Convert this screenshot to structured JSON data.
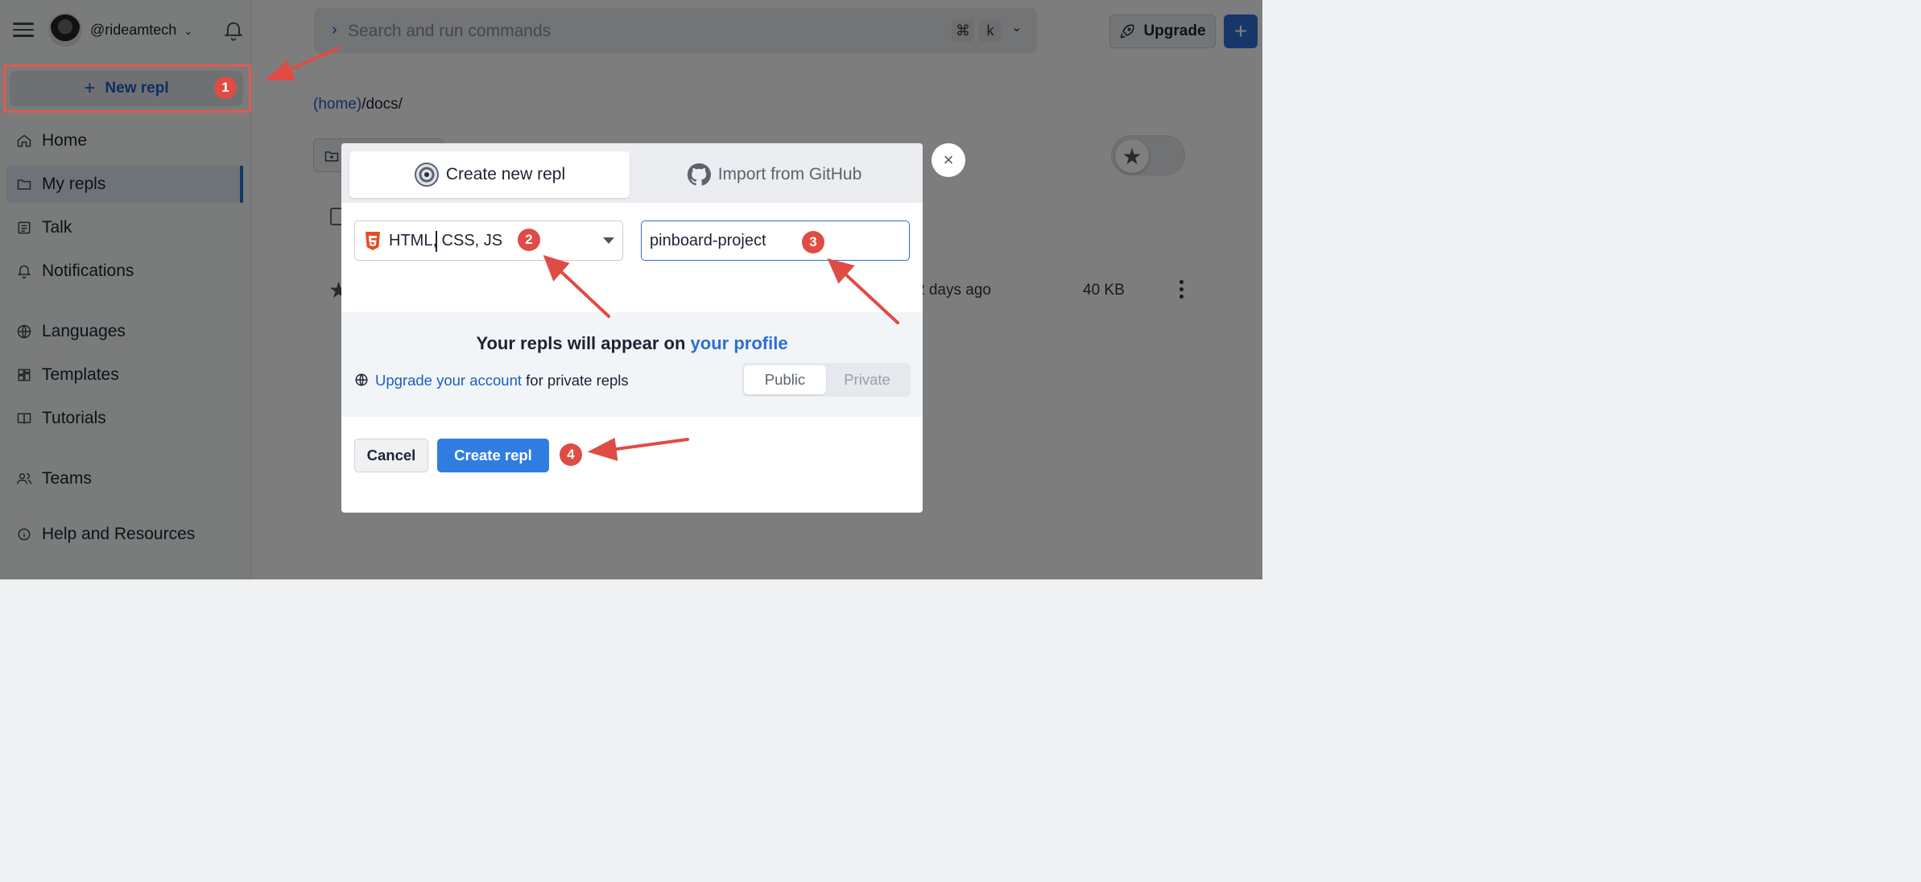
{
  "sidebar": {
    "username": "@rideamtech",
    "new_repl_label": "New repl",
    "items": [
      {
        "label": "Home",
        "icon": "home-icon"
      },
      {
        "label": "My repls",
        "icon": "folder-icon"
      },
      {
        "label": "Talk",
        "icon": "list-icon"
      },
      {
        "label": "Notifications",
        "icon": "bell-icon"
      },
      {
        "label": "Languages",
        "icon": "globe-icon"
      },
      {
        "label": "Templates",
        "icon": "templates-icon"
      },
      {
        "label": "Tutorials",
        "icon": "book-icon"
      },
      {
        "label": "Teams",
        "icon": "users-icon"
      },
      {
        "label": "Help and Resources",
        "icon": "info-icon"
      }
    ]
  },
  "header": {
    "search_placeholder": "Search and run commands",
    "shortcut_cmd": "⌘",
    "shortcut_key": "k",
    "upgrade_label": "Upgrade",
    "add_label": "+"
  },
  "main": {
    "breadcrumb_home": "(home)",
    "breadcrumb_rest": "/docs/",
    "row_date": "2 days ago",
    "row_size": "40 KB"
  },
  "modal": {
    "tab_create": "Create new repl",
    "tab_import": "Import from GitHub",
    "language_value": "HTML, CSS, JS",
    "name_value": "pinboard-project",
    "info_title_prefix": "Your repls will appear on ",
    "info_title_link": "your profile",
    "info_sub_link": "Upgrade your account",
    "info_sub_suffix": " for private repls",
    "visibility_public": "Public",
    "visibility_private": "Private",
    "cancel_label": "Cancel",
    "create_label": "Create repl",
    "close_glyph": "×"
  },
  "annotations": {
    "badges": [
      "1",
      "2",
      "3",
      "4"
    ],
    "color": "#df4c45"
  }
}
